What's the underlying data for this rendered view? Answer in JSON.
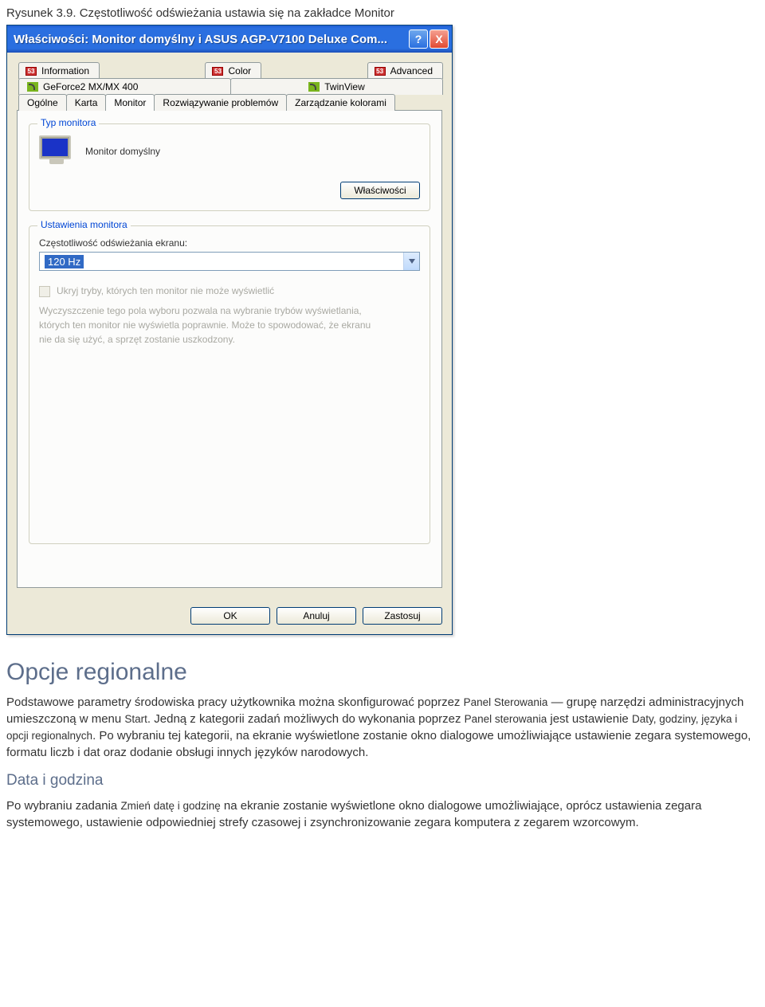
{
  "caption": "Rysunek 3.9. Częstotliwość odświeżania ustawia się na zakładce Monitor",
  "titlebar": "Właściwości: Monitor domyślny i ASUS AGP-V7100 Deluxe Com...",
  "help_char": "?",
  "close_char": "X",
  "tabs_row1": {
    "info": "Information",
    "color": "Color",
    "advanced": "Advanced"
  },
  "tabs_row2": {
    "geforce": "GeForce2 MX/MX 400",
    "twinview": "TwinView"
  },
  "tabs_row3": {
    "general": "Ogólne",
    "card": "Karta",
    "monitor": "Monitor",
    "troubleshoot": "Rozwiązywanie problemów",
    "colormgmt": "Zarządzanie kolorami"
  },
  "group_monitor": {
    "legend": "Typ monitora",
    "name": "Monitor domyślny",
    "props_btn": "Właściwości"
  },
  "group_settings": {
    "legend": "Ustawienia monitora",
    "label": "Częstotliwość odświeżania ekranu:",
    "value": "120 Hz",
    "cb_label": "Ukryj tryby, których ten monitor nie może wyświetlić",
    "note": "Wyczyszczenie tego pola wyboru pozwala na wybranie trybów wyświetlania, których ten monitor nie wyświetla poprawnie. Może to spowodować, że ekranu nie da się użyć, a sprzęt zostanie uszkodzony."
  },
  "dlg_buttons": {
    "ok": "OK",
    "cancel": "Anuluj",
    "apply": "Zastosuj"
  },
  "doc": {
    "h2": "Opcje regionalne",
    "p1_before": "Podstawowe parametry środowiska pracy użytkownika można skonfigurować poprzez ",
    "p1_em1": "Panel Sterowania",
    "p1_mid": " — grupę narzędzi administracyjnych umieszczoną w menu ",
    "p1_em2": "Start",
    "p1_after": ". Jedną z kategorii zadań możliwych do wykonania poprzez ",
    "p1_em3": "Panel sterowania",
    "p1_after2": " jest ustawienie ",
    "p1_em4": "Daty, godziny, języka i opcji regionalnych",
    "p1_end": ". Po wybraniu tej kategorii, na ekranie wyświetlone zostanie okno dialogowe umożliwiające ustawienie zegara systemowego, formatu liczb i dat oraz dodanie obsługi innych języków narodowych.",
    "h3": "Data i godzina",
    "p2_before": "Po wybraniu zadania ",
    "p2_em1": "Zmień datę i godzinę",
    "p2_after": " na ekranie zostanie wyświetlone okno dialogowe umożliwiające, oprócz ustawienia zegara systemowego, ustawienie odpowiedniej strefy czasowej i zsynchronizowanie zegara komputera z zegarem wzorcowym."
  }
}
